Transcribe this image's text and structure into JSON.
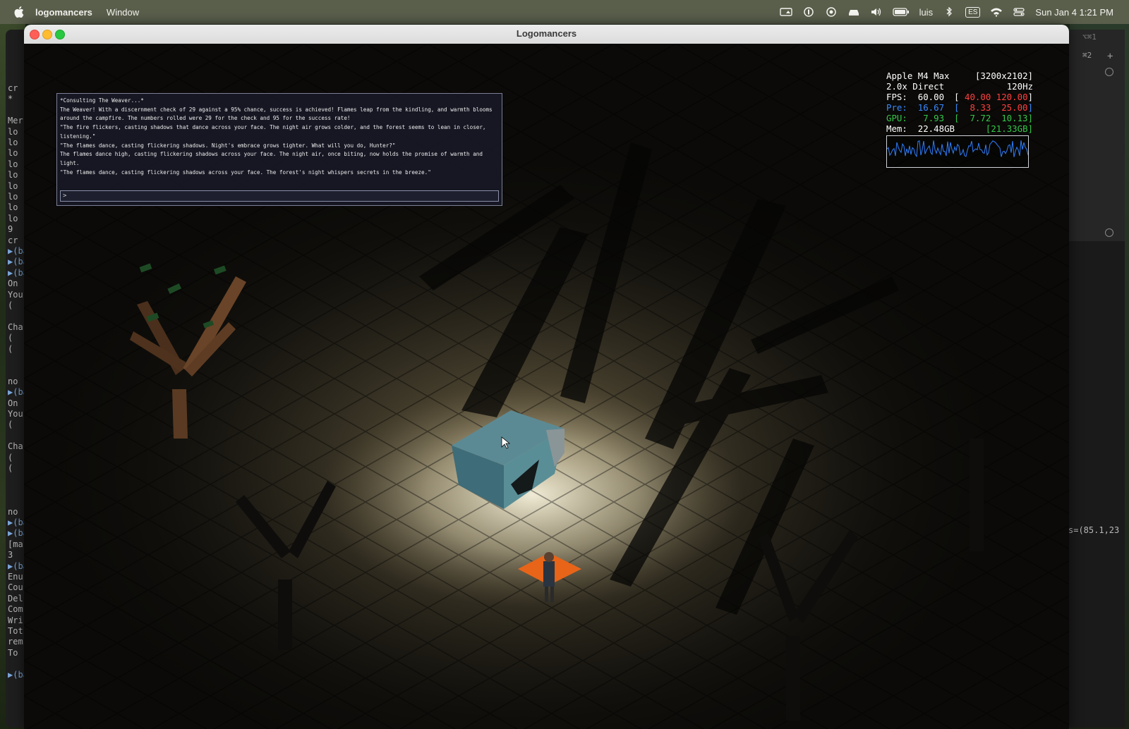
{
  "menubar": {
    "app_name": "logomancers",
    "items": [
      "Window"
    ],
    "user": "luis",
    "language": "ES",
    "datetime": "Sun Jan 4  1:21 PM"
  },
  "window": {
    "title": "Logomancers"
  },
  "chat": {
    "messages": [
      "*Consulting The Weaver...*",
      "The Weaver! With a discernment check of 29 against a 95% chance, success is achieved! Flames leap from the kindling, and warmth blooms around the campfire. The numbers rolled were 29 for the check and 95 for the success rate!",
      "\"The fire flickers, casting shadows that dance across your face. The night air grows colder, and the forest seems to lean in closer, listening.\"",
      "\"The flames dance, casting flickering shadows. Night's embrace grows tighter. What will you do, Hunter?\"",
      "The flames dance high, casting flickering shadows across your face. The night air, once biting, now holds the promise of warmth and light.",
      "\"The flames dance, casting flickering shadows across your face. The forest's night whispers secrets in the breeze.\""
    ],
    "input_value": ">"
  },
  "perf": {
    "device": "Apple M4 Max",
    "resolution": "[3200x2102]",
    "scale": "2.0x Direct",
    "refresh": "120Hz",
    "fps_label": "FPS:",
    "fps": "60.00",
    "fps_min": "40.00",
    "fps_max": "120.00",
    "pre_label": "Pre:",
    "pre": "16.67",
    "pre_min": "8.33",
    "pre_max": "25.00",
    "gpu_label": "GPU:",
    "gpu": "7.93",
    "gpu_min": "7.72",
    "gpu_max": "10.13",
    "mem_label": "Mem:",
    "mem": "22.48GB",
    "mem_total": "[21.33GB]",
    "colors": {
      "fps_range": "#ff4040",
      "pre": "#3a8aff",
      "gpu": "#34c84a",
      "graph": "#2f7fff"
    }
  },
  "terminal_left": {
    "lines": [
      "cr",
      "*",
      "",
      "Mer",
      "lo",
      "lo",
      "lo",
      "lo",
      "lo",
      "lo",
      "lo",
      "lo",
      "lo",
      "9",
      "cr",
      "▶(ba",
      "▶(ba",
      "▶(ba",
      "On",
      "You",
      "  (",
      "",
      "Cha",
      "  (",
      "  (",
      "",
      "",
      "no",
      "▶(ba",
      "On",
      "You",
      "  (",
      "",
      "Cha",
      "  (",
      "  (",
      "",
      "",
      "",
      "no",
      "▶(ba",
      "▶(ba",
      "[ma",
      "3",
      "▶(ba",
      "Enu",
      "Cou",
      "Del",
      "Com",
      "Wri",
      "Tot",
      "rem",
      "To",
      "",
      "▶(ba"
    ]
  },
  "terminal_right": {
    "shortcut_1": "⌥⌘1",
    "shortcut_2": "⌘2",
    "coord_text": "s=(85.1,23"
  }
}
